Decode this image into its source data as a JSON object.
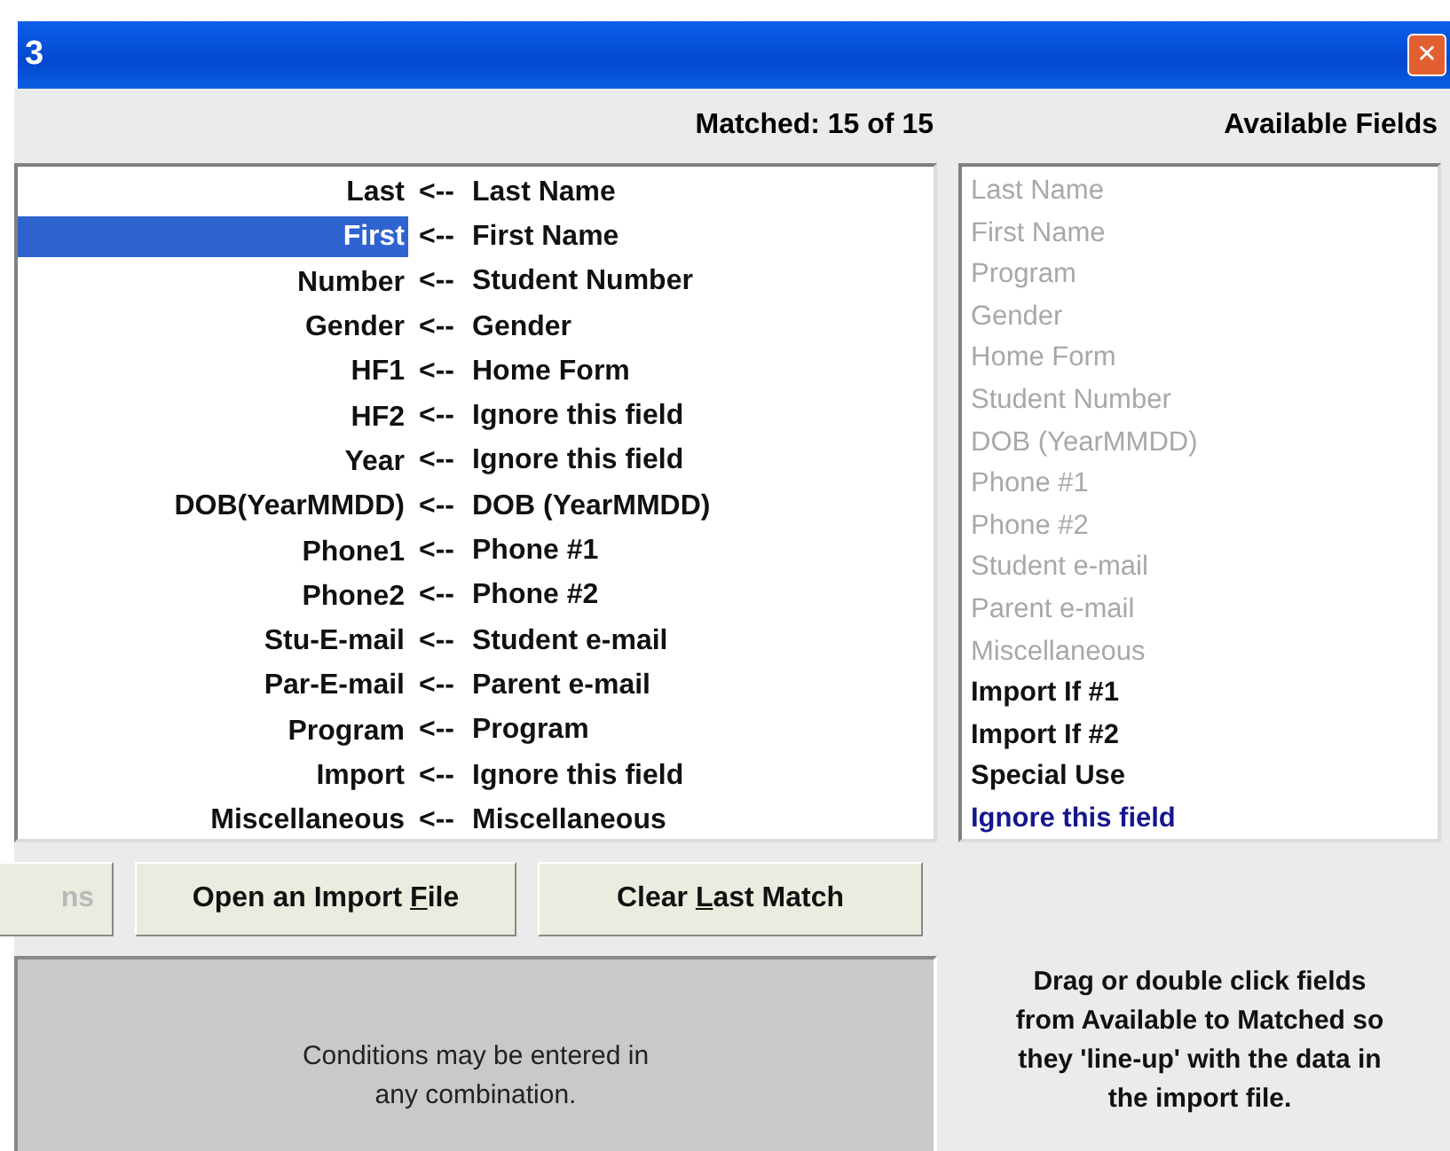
{
  "window": {
    "title": "3",
    "close": "✕"
  },
  "matched": {
    "heading": "Matched: 15 of 15",
    "rows": [
      {
        "import_field": "Last",
        "arrow": "<--",
        "field": "Last Name",
        "selected": false
      },
      {
        "import_field": "First",
        "arrow": "<--",
        "field": "First Name",
        "selected": true
      },
      {
        "import_field": "Number",
        "arrow": "<--",
        "field": "Student Number",
        "selected": false
      },
      {
        "import_field": "Gender",
        "arrow": "<--",
        "field": "Gender",
        "selected": false
      },
      {
        "import_field": "HF1",
        "arrow": "<--",
        "field": "Home Form",
        "selected": false
      },
      {
        "import_field": "HF2",
        "arrow": "<--",
        "field": "Ignore this field",
        "selected": false
      },
      {
        "import_field": "Year",
        "arrow": "<--",
        "field": "Ignore this field",
        "selected": false
      },
      {
        "import_field": "DOB(YearMMDD)",
        "arrow": "<--",
        "field": "DOB (YearMMDD)",
        "selected": false
      },
      {
        "import_field": "Phone1",
        "arrow": "<--",
        "field": "Phone #1",
        "selected": false
      },
      {
        "import_field": "Phone2",
        "arrow": "<--",
        "field": "Phone #2",
        "selected": false
      },
      {
        "import_field": "Stu-E-mail",
        "arrow": "<--",
        "field": "Student e-mail",
        "selected": false
      },
      {
        "import_field": "Par-E-mail",
        "arrow": "<--",
        "field": "Parent e-mail",
        "selected": false
      },
      {
        "import_field": "Program",
        "arrow": "<--",
        "field": "Program",
        "selected": false
      },
      {
        "import_field": "Import",
        "arrow": "<--",
        "field": "Ignore this field",
        "selected": false
      },
      {
        "import_field": "Miscellaneous",
        "arrow": "<--",
        "field": "Miscellaneous",
        "selected": false
      }
    ]
  },
  "available": {
    "heading": "Available Fields",
    "items": [
      {
        "label": "Last Name",
        "kind": "used"
      },
      {
        "label": "First Name",
        "kind": "used"
      },
      {
        "label": "Program",
        "kind": "used"
      },
      {
        "label": "Gender",
        "kind": "used"
      },
      {
        "label": "Home Form",
        "kind": "used"
      },
      {
        "label": "Student Number",
        "kind": "used"
      },
      {
        "label": "DOB (YearMMDD)",
        "kind": "used"
      },
      {
        "label": "Phone #1",
        "kind": "used"
      },
      {
        "label": "Phone #2",
        "kind": "used"
      },
      {
        "label": "Student e-mail",
        "kind": "used"
      },
      {
        "label": "Parent e-mail",
        "kind": "used"
      },
      {
        "label": "Miscellaneous",
        "kind": "used"
      },
      {
        "label": "Import If #1",
        "kind": "free"
      },
      {
        "label": "Import If #2",
        "kind": "free"
      },
      {
        "label": "Special Use",
        "kind": "free"
      },
      {
        "label": "Ignore this field",
        "kind": "ignore"
      }
    ]
  },
  "buttons": [
    {
      "before": "ns",
      "disabled": true
    },
    {
      "before": "Open an Import ",
      "mnemonic": "F",
      "after": "ile",
      "disabled": false
    },
    {
      "before": "Clear ",
      "mnemonic": "L",
      "after": "ast Match",
      "disabled": false
    }
  ],
  "conditions": {
    "text": "Conditions may be entered in any combination."
  },
  "help": "Drag or double click fields from Available to Matched so they 'line-up' with the data in the import file."
}
